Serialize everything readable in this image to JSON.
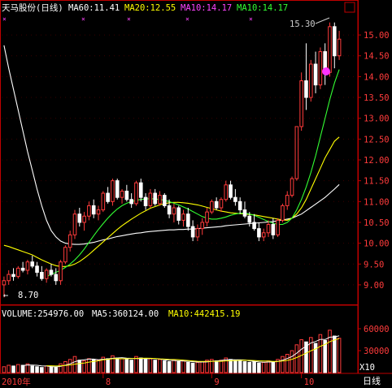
{
  "chart_data": {
    "type": "candlestick",
    "stock_title": "天马股份(日线)",
    "ma_labels": [
      {
        "text": "MA60:11.41",
        "color": "#ffffff"
      },
      {
        "text": "MA20:12.55",
        "color": "#ffff00"
      },
      {
        "text": "MA10:14.17",
        "color": "#ff44ff"
      },
      {
        "text": "MA10:14.17",
        "color": "#33ff33"
      }
    ],
    "volume_labels": [
      {
        "text": "VOLUME:254976.00",
        "color": "#ffffff"
      },
      {
        "text": "MA5:360124.00",
        "color": "#ffffff"
      },
      {
        "text": "MA10:442415.19",
        "color": "#ffff00"
      }
    ],
    "y_ticks": [
      "15.00",
      "14.50",
      "14.00",
      "13.50",
      "13.00",
      "12.50",
      "12.00",
      "11.50",
      "11.00",
      "10.50",
      "10.00",
      "9.50",
      "9.00"
    ],
    "y_range": [
      8.55,
      15.45
    ],
    "vol_ticks": [
      "60000",
      "30000"
    ],
    "vol_unit": "X10",
    "period_label": "日线",
    "date_labels": [
      "2010年",
      "8",
      "9",
      "10"
    ],
    "high_annotation": "15.30",
    "low_annotation": "8.70",
    "candles": [
      {
        "o": 9.0,
        "h": 9.2,
        "l": 8.7,
        "c": 9.1
      },
      {
        "o": 9.1,
        "h": 9.35,
        "l": 9.0,
        "c": 9.25
      },
      {
        "o": 9.25,
        "h": 9.4,
        "l": 9.1,
        "c": 9.2
      },
      {
        "o": 9.2,
        "h": 9.45,
        "l": 9.15,
        "c": 9.4
      },
      {
        "o": 9.4,
        "h": 9.55,
        "l": 9.3,
        "c": 9.35
      },
      {
        "o": 9.35,
        "h": 9.6,
        "l": 9.25,
        "c": 9.55
      },
      {
        "o": 9.55,
        "h": 9.7,
        "l": 9.4,
        "c": 9.45
      },
      {
        "o": 9.45,
        "h": 9.55,
        "l": 9.2,
        "c": 9.3
      },
      {
        "o": 9.3,
        "h": 9.45,
        "l": 9.1,
        "c": 9.15
      },
      {
        "o": 9.15,
        "h": 9.4,
        "l": 9.05,
        "c": 9.35
      },
      {
        "o": 9.35,
        "h": 9.5,
        "l": 9.2,
        "c": 9.25
      },
      {
        "o": 9.25,
        "h": 9.4,
        "l": 9.0,
        "c": 9.1
      },
      {
        "o": 9.1,
        "h": 9.6,
        "l": 9.0,
        "c": 9.55
      },
      {
        "o": 9.55,
        "h": 9.95,
        "l": 9.5,
        "c": 9.9
      },
      {
        "o": 9.9,
        "h": 10.3,
        "l": 9.8,
        "c": 10.2
      },
      {
        "o": 10.2,
        "h": 10.8,
        "l": 10.1,
        "c": 10.7
      },
      {
        "o": 10.7,
        "h": 10.85,
        "l": 10.4,
        "c": 10.5
      },
      {
        "o": 10.5,
        "h": 10.75,
        "l": 10.3,
        "c": 10.65
      },
      {
        "o": 10.65,
        "h": 11.0,
        "l": 10.55,
        "c": 10.9
      },
      {
        "o": 10.9,
        "h": 11.05,
        "l": 10.6,
        "c": 10.7
      },
      {
        "o": 10.7,
        "h": 10.9,
        "l": 10.55,
        "c": 10.8
      },
      {
        "o": 10.8,
        "h": 11.25,
        "l": 10.75,
        "c": 11.2
      },
      {
        "o": 11.2,
        "h": 11.35,
        "l": 10.95,
        "c": 11.0
      },
      {
        "o": 11.0,
        "h": 11.55,
        "l": 10.9,
        "c": 11.5
      },
      {
        "o": 11.5,
        "h": 11.55,
        "l": 11.05,
        "c": 11.1
      },
      {
        "o": 11.1,
        "h": 11.3,
        "l": 10.95,
        "c": 11.25
      },
      {
        "o": 11.25,
        "h": 11.4,
        "l": 11.0,
        "c": 11.05
      },
      {
        "o": 11.05,
        "h": 11.2,
        "l": 10.85,
        "c": 10.95
      },
      {
        "o": 10.95,
        "h": 11.5,
        "l": 10.9,
        "c": 11.45
      },
      {
        "o": 11.45,
        "h": 11.55,
        "l": 11.0,
        "c": 11.1
      },
      {
        "o": 11.1,
        "h": 11.2,
        "l": 10.8,
        "c": 10.9
      },
      {
        "o": 10.9,
        "h": 11.3,
        "l": 10.85,
        "c": 11.2
      },
      {
        "o": 11.2,
        "h": 11.3,
        "l": 10.9,
        "c": 10.95
      },
      {
        "o": 10.95,
        "h": 11.25,
        "l": 10.9,
        "c": 11.15
      },
      {
        "o": 11.15,
        "h": 11.2,
        "l": 10.85,
        "c": 10.9
      },
      {
        "o": 10.9,
        "h": 11.05,
        "l": 10.6,
        "c": 10.7
      },
      {
        "o": 10.7,
        "h": 10.95,
        "l": 10.5,
        "c": 10.85
      },
      {
        "o": 10.85,
        "h": 10.9,
        "l": 10.45,
        "c": 10.55
      },
      {
        "o": 10.55,
        "h": 10.8,
        "l": 10.4,
        "c": 10.7
      },
      {
        "o": 10.7,
        "h": 10.85,
        "l": 10.3,
        "c": 10.4
      },
      {
        "o": 10.4,
        "h": 10.55,
        "l": 10.05,
        "c": 10.15
      },
      {
        "o": 10.15,
        "h": 10.45,
        "l": 10.05,
        "c": 10.35
      },
      {
        "o": 10.35,
        "h": 10.6,
        "l": 10.2,
        "c": 10.5
      },
      {
        "o": 10.5,
        "h": 10.85,
        "l": 10.4,
        "c": 10.75
      },
      {
        "o": 10.75,
        "h": 11.05,
        "l": 10.7,
        "c": 11.0
      },
      {
        "o": 11.0,
        "h": 11.1,
        "l": 10.8,
        "c": 10.85
      },
      {
        "o": 10.85,
        "h": 11.1,
        "l": 10.75,
        "c": 11.05
      },
      {
        "o": 11.05,
        "h": 11.5,
        "l": 11.0,
        "c": 11.4
      },
      {
        "o": 11.4,
        "h": 11.5,
        "l": 11.05,
        "c": 11.1
      },
      {
        "o": 11.1,
        "h": 11.3,
        "l": 10.9,
        "c": 11.0
      },
      {
        "o": 11.0,
        "h": 11.1,
        "l": 10.7,
        "c": 10.8
      },
      {
        "o": 10.8,
        "h": 11.0,
        "l": 10.6,
        "c": 10.65
      },
      {
        "o": 10.65,
        "h": 10.75,
        "l": 10.4,
        "c": 10.5
      },
      {
        "o": 10.5,
        "h": 10.7,
        "l": 10.3,
        "c": 10.35
      },
      {
        "o": 10.35,
        "h": 10.5,
        "l": 10.05,
        "c": 10.15
      },
      {
        "o": 10.15,
        "h": 10.35,
        "l": 10.05,
        "c": 10.25
      },
      {
        "o": 10.25,
        "h": 10.55,
        "l": 10.15,
        "c": 10.45
      },
      {
        "o": 10.45,
        "h": 10.6,
        "l": 10.1,
        "c": 10.2
      },
      {
        "o": 10.2,
        "h": 10.6,
        "l": 10.15,
        "c": 10.55
      },
      {
        "o": 10.55,
        "h": 10.95,
        "l": 10.5,
        "c": 10.9
      },
      {
        "o": 10.9,
        "h": 11.25,
        "l": 10.8,
        "c": 11.15
      },
      {
        "o": 11.15,
        "h": 11.6,
        "l": 11.1,
        "c": 11.55
      },
      {
        "o": 11.55,
        "h": 12.8,
        "l": 11.5,
        "c": 12.8
      },
      {
        "o": 12.8,
        "h": 14.1,
        "l": 12.7,
        "c": 13.9
      },
      {
        "o": 13.9,
        "h": 14.8,
        "l": 13.2,
        "c": 13.5
      },
      {
        "o": 13.5,
        "h": 14.4,
        "l": 13.4,
        "c": 14.3
      },
      {
        "o": 14.3,
        "h": 14.6,
        "l": 13.6,
        "c": 13.8
      },
      {
        "o": 13.8,
        "h": 14.7,
        "l": 13.7,
        "c": 14.6
      },
      {
        "o": 14.6,
        "h": 14.8,
        "l": 13.8,
        "c": 14.1
      },
      {
        "o": 14.1,
        "h": 15.3,
        "l": 14.0,
        "c": 15.2
      },
      {
        "o": 15.2,
        "h": 15.3,
        "l": 14.2,
        "c": 14.5
      },
      {
        "o": 14.5,
        "h": 15.1,
        "l": 14.4,
        "c": 14.9
      }
    ],
    "volumes": [
      8,
      10,
      9,
      11,
      10,
      12,
      9,
      8,
      7,
      9,
      8,
      7,
      12,
      15,
      18,
      22,
      17,
      16,
      19,
      18,
      17,
      21,
      19,
      23,
      20,
      19,
      18,
      17,
      22,
      20,
      18,
      19,
      17,
      18,
      16,
      15,
      17,
      15,
      16,
      14,
      13,
      14,
      15,
      17,
      18,
      16,
      17,
      20,
      18,
      17,
      16,
      15,
      14,
      15,
      13,
      14,
      16,
      15,
      18,
      22,
      25,
      30,
      38,
      45,
      42,
      48,
      40,
      52,
      44,
      58,
      50,
      47
    ],
    "ma60": [
      14.75,
      14.2,
      13.7,
      13.2,
      12.7,
      12.2,
      11.75,
      11.3,
      10.9,
      10.55,
      10.3,
      10.15,
      10.05,
      10.0,
      9.98,
      9.97,
      9.97,
      9.98,
      10.0,
      10.02,
      10.05,
      10.08,
      10.1,
      10.13,
      10.16,
      10.18,
      10.2,
      10.22,
      10.24,
      10.25,
      10.27,
      10.28,
      10.29,
      10.3,
      10.31,
      10.32,
      10.32,
      10.33,
      10.33,
      10.34,
      10.34,
      10.35,
      10.36,
      10.37,
      10.38,
      10.39,
      10.4,
      10.42,
      10.43,
      10.44,
      10.45,
      10.46,
      10.47,
      10.48,
      10.49,
      10.5,
      10.51,
      10.52,
      10.54,
      10.56,
      10.58,
      10.6,
      10.65,
      10.7,
      10.78,
      10.86,
      10.94,
      11.02,
      11.1,
      11.2,
      11.3,
      11.41
    ],
    "ma20": [
      9.95,
      9.92,
      9.88,
      9.84,
      9.8,
      9.76,
      9.72,
      9.66,
      9.6,
      9.55,
      9.5,
      9.46,
      9.44,
      9.44,
      9.46,
      9.5,
      9.56,
      9.64,
      9.73,
      9.83,
      9.93,
      10.03,
      10.13,
      10.23,
      10.33,
      10.42,
      10.5,
      10.58,
      10.65,
      10.72,
      10.78,
      10.84,
      10.88,
      10.92,
      10.95,
      10.97,
      10.98,
      10.98,
      10.97,
      10.96,
      10.94,
      10.92,
      10.89,
      10.86,
      10.83,
      10.8,
      10.77,
      10.75,
      10.73,
      10.72,
      10.71,
      10.7,
      10.69,
      10.68,
      10.66,
      10.64,
      10.62,
      10.6,
      10.58,
      10.56,
      10.55,
      10.6,
      10.7,
      10.85,
      11.05,
      11.3,
      11.55,
      11.8,
      12.05,
      12.25,
      12.45,
      12.55
    ],
    "ma10": [
      null,
      null,
      null,
      null,
      null,
      null,
      null,
      null,
      null,
      9.2,
      9.25,
      9.3,
      9.35,
      9.42,
      9.5,
      9.6,
      9.72,
      9.86,
      10.02,
      10.18,
      10.33,
      10.47,
      10.6,
      10.72,
      10.82,
      10.9,
      10.96,
      11.0,
      11.03,
      11.05,
      11.06,
      11.07,
      11.06,
      11.05,
      11.03,
      11.0,
      10.96,
      10.92,
      10.87,
      10.82,
      10.76,
      10.7,
      10.64,
      10.6,
      10.58,
      10.58,
      10.6,
      10.63,
      10.67,
      10.7,
      10.72,
      10.72,
      10.7,
      10.67,
      10.62,
      10.57,
      10.52,
      10.48,
      10.45,
      10.45,
      10.5,
      10.6,
      10.8,
      11.05,
      11.35,
      11.7,
      12.1,
      12.55,
      13.0,
      13.45,
      13.85,
      14.17
    ]
  }
}
